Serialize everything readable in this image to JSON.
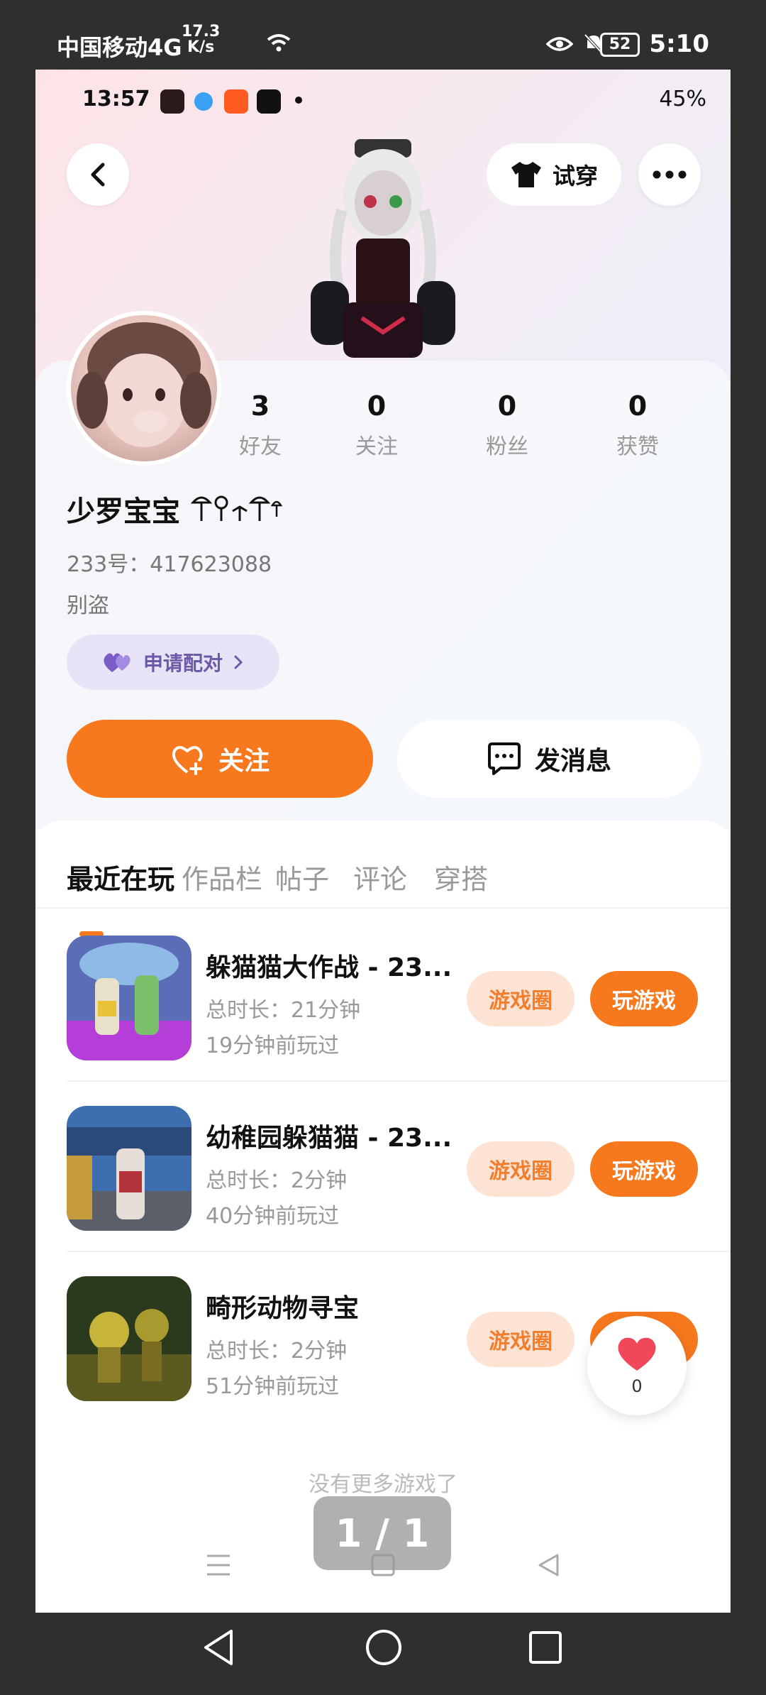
{
  "outer_status": {
    "carrier": "中国移动4G",
    "net_speed_value": "17.3",
    "net_speed_unit": "K/s",
    "battery": "52",
    "time": "5:10"
  },
  "inner_status": {
    "time": "13:57",
    "battery_percent": "45%"
  },
  "header": {
    "try_on_label": "试穿"
  },
  "profile": {
    "username": "少罗宝宝",
    "id_label": "233号：",
    "id_value": "417623088",
    "bio": "别盗",
    "pair_label": "申请配对",
    "stats": [
      {
        "value": "3",
        "label": "好友"
      },
      {
        "value": "0",
        "label": "关注"
      },
      {
        "value": "0",
        "label": "粉丝"
      },
      {
        "value": "0",
        "label": "获赞"
      }
    ]
  },
  "actions": {
    "follow_label": "关注",
    "message_label": "发消息"
  },
  "tabs": [
    "最近在玩",
    "作品栏",
    "帖子",
    "评论",
    "穿搭"
  ],
  "games": [
    {
      "name": "躲猫猫大作战 - 23...",
      "duration": "总时长：21分钟",
      "last_played": "19分钟前玩过",
      "circle_label": "游戏圈",
      "play_label": "玩游戏"
    },
    {
      "name": "幼稚园躲猫猫 - 23...",
      "duration": "总时长：2分钟",
      "last_played": "40分钟前玩过",
      "circle_label": "游戏圈",
      "play_label": "玩游戏"
    },
    {
      "name": "畸形动物寻宝",
      "duration": "总时长：2分钟",
      "last_played": "51分钟前玩过",
      "circle_label": "游戏圈",
      "play_label": "玩游戏"
    }
  ],
  "floating_like": {
    "count": "0"
  },
  "footer": {
    "no_more": "没有更多游戏了",
    "pager": "1 / 1"
  },
  "colors": {
    "accent": "#f8781d",
    "accent_light": "#fde3d3",
    "pair_bg": "#e9e3f7"
  }
}
